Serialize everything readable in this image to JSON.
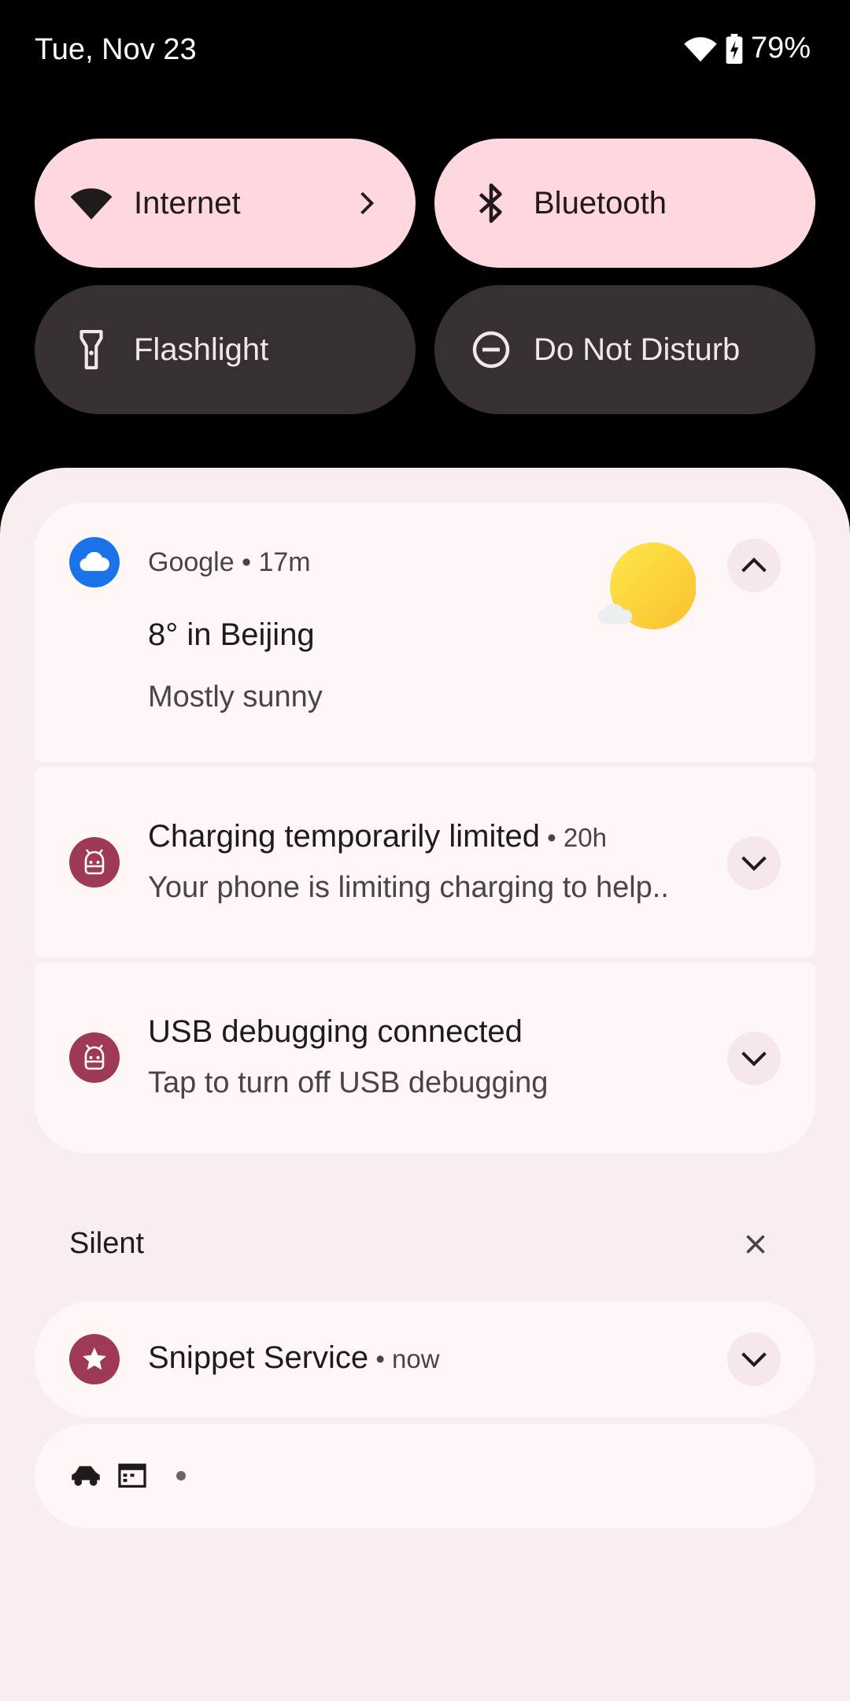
{
  "status_bar": {
    "date": "Tue, Nov 23",
    "battery": "79%",
    "icons": [
      "wifi-icon",
      "battery-charging-icon"
    ]
  },
  "quick_settings": {
    "tiles": [
      {
        "label": "Internet",
        "icon": "wifi-icon",
        "state": "on",
        "has_chevron": true
      },
      {
        "label": "Bluetooth",
        "icon": "bluetooth-icon",
        "state": "on"
      },
      {
        "label": "Flashlight",
        "icon": "flashlight-icon",
        "state": "off"
      },
      {
        "label": "Do Not Disturb",
        "icon": "do-not-disturb-icon",
        "state": "off"
      }
    ]
  },
  "notifications": [
    {
      "app": "Google",
      "time": "17m",
      "title": "8° in Beijing",
      "body": "Mostly sunny",
      "icon": "cloud-icon",
      "expanded": true
    },
    {
      "title": "Charging temporarily limited",
      "time": "20h",
      "body": "Your phone is limiting charging to help..",
      "icon": "android-icon"
    },
    {
      "title": "USB debugging connected",
      "body": "Tap to turn off USB debugging",
      "icon": "android-icon"
    }
  ],
  "silent": {
    "header": "Silent",
    "items": [
      {
        "title": "Snippet Service",
        "time": "now",
        "icon": "star-icon"
      }
    ],
    "overflow_icons": [
      "car-icon",
      "calendar-icon"
    ]
  },
  "colors": {
    "tile_on": "#ffd8df",
    "tile_off": "#363031",
    "shade_bg": "#f8eeee",
    "card_bg": "#fff7f6",
    "app_icon_rose": "#9e3a55",
    "app_icon_blue": "#1a73e8",
    "sun": "#fdd835"
  }
}
